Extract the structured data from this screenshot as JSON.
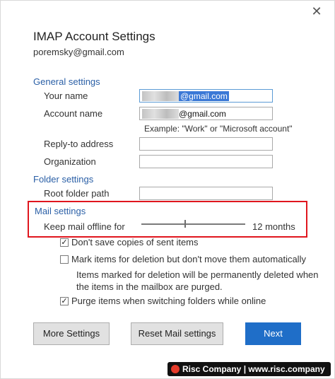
{
  "window": {
    "close_glyph": "✕"
  },
  "header": {
    "title": "IMAP Account Settings",
    "email": "poremsky@gmail.com"
  },
  "general": {
    "heading": "General settings",
    "your_name_label": "Your name",
    "your_name_value": "@gmail.com",
    "account_name_label": "Account name",
    "account_name_value": "@gmail.com",
    "example_hint": "Example: \"Work\" or \"Microsoft account\"",
    "reply_to_label": "Reply-to address",
    "reply_to_value": "",
    "organization_label": "Organization",
    "organization_value": ""
  },
  "folder": {
    "heading": "Folder settings",
    "root_folder_label": "Root folder path",
    "root_folder_value": ""
  },
  "mail": {
    "heading": "Mail settings",
    "offline_label": "Keep mail offline for",
    "offline_value_text": "12 months",
    "offline_slider_fraction": 0.42,
    "dont_save_sent_label": "Don't save copies of sent items",
    "dont_save_sent_checked": true,
    "mark_delete_label": "Mark items for deletion but don't move them automatically",
    "mark_delete_checked": false,
    "mark_delete_note_line1": "Items marked for deletion will be permanently deleted when",
    "mark_delete_note_line2": "the items in the mailbox are purged.",
    "purge_label": "Purge items when switching folders while online",
    "purge_checked": true
  },
  "buttons": {
    "more_settings": "More Settings",
    "reset_mail": "Reset Mail settings",
    "next": "Next"
  },
  "watermark": {
    "text": "Risc Company | www.risc.company"
  },
  "colors": {
    "section_blue": "#2a5fa6",
    "highlight_red": "#e0161e",
    "primary_button": "#1f6ec8"
  }
}
